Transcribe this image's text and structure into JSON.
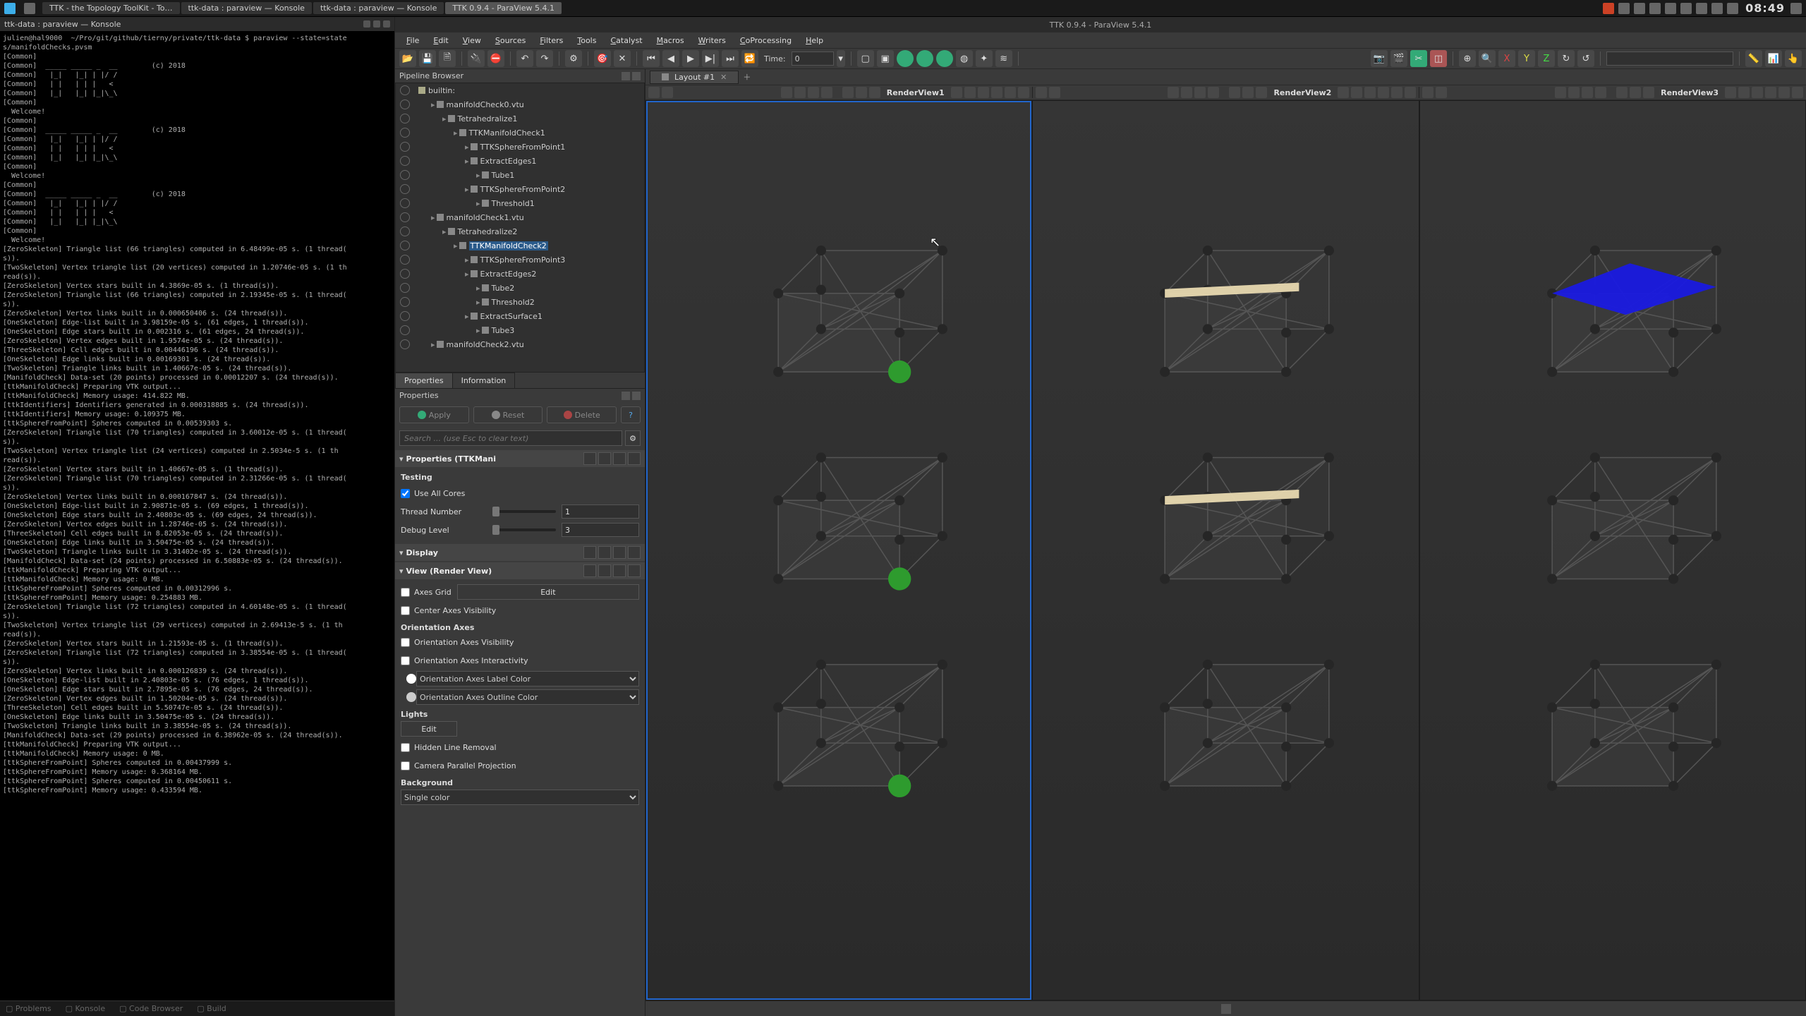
{
  "os": {
    "tasks": [
      {
        "label": "TTK - the Topology ToolKit - To…",
        "active": false
      },
      {
        "label": "ttk-data : paraview — Konsole",
        "active": false
      },
      {
        "label": "ttk-data : paraview — Konsole",
        "active": false
      },
      {
        "label": "TTK 0.9.4 - ParaView 5.4.1",
        "active": true
      }
    ],
    "clock": "08:49"
  },
  "terminal": {
    "title": "ttk-data : paraview — Konsole",
    "prompt": "julien@hal9000  ~/Pro/git/github/tierny/private/ttk-data $ paraview --state=state",
    "statefile": "s/manifoldChecks.pvsm",
    "welcome": "  Welcome!",
    "banner_left": "TTK",
    "banner_right": "(c) 2018",
    "lines": [
      "[ZeroSkeleton] Triangle list (66 triangles) computed in 6.48499e-05 s. (1 thread(",
      "s)).",
      "[TwoSkeleton] Vertex triangle list (20 vertices) computed in 1.20746e-05 s. (1 th",
      "read(s)).",
      "[ZeroSkeleton] Vertex stars built in 4.3869e-05 s. (1 thread(s)).",
      "[ZeroSkeleton] Triangle list (66 triangles) computed in 2.19345e-05 s. (1 thread(",
      "s)).",
      "[ZeroSkeleton] Vertex links built in 0.000650406 s. (24 thread(s)).",
      "[OneSkeleton] Edge-list built in 3.98159e-05 s. (61 edges, 1 thread(s)).",
      "[OneSkeleton] Edge stars built in 0.002316 s. (61 edges, 24 thread(s)).",
      "[ZeroSkeleton] Vertex edges built in 1.9574e-05 s. (24 thread(s)).",
      "[ThreeSkeleton] Cell edges built in 0.00446196 s. (24 thread(s)).",
      "[OneSkeleton] Edge links built in 0.00169301 s. (24 thread(s)).",
      "[TwoSkeleton] Triangle links built in 1.40667e-05 s. (24 thread(s)).",
      "[ManifoldCheck] Data-set (20 points) processed in 0.00012207 s. (24 thread(s)).",
      "[ttkManifoldCheck] Preparing VTK output...",
      "[ttkManifoldCheck] Memory usage: 414.822 MB.",
      "[ttkIdentifiers] Identifiers generated in 0.000318885 s. (24 thread(s)).",
      "[ttkIdentifiers] Memory usage: 0.109375 MB.",
      "[ttkSphereFromPoint] Spheres computed in 0.00539303 s.",
      "[ZeroSkeleton] Triangle list (70 triangles) computed in 3.60012e-05 s. (1 thread(",
      "s)).",
      "[TwoSkeleton] Vertex triangle list (24 vertices) computed in 2.5034e-5 s. (1 th",
      "read(s)).",
      "[ZeroSkeleton] Vertex stars built in 1.40667e-05 s. (1 thread(s)).",
      "[ZeroSkeleton] Triangle list (70 triangles) computed in 2.31266e-05 s. (1 thread(",
      "s)).",
      "[ZeroSkeleton] Vertex links built in 0.000167847 s. (24 thread(s)).",
      "[OneSkeleton] Edge-list built in 2.90871e-05 s. (69 edges, 1 thread(s)).",
      "[OneSkeleton] Edge stars built in 2.40803e-05 s. (69 edges, 24 thread(s)).",
      "[ZeroSkeleton] Vertex edges built in 1.28746e-05 s. (24 thread(s)).",
      "[ThreeSkeleton] Cell edges built in 8.82053e-05 s. (24 thread(s)).",
      "[OneSkeleton] Edge links built in 3.50475e-05 s. (24 thread(s)).",
      "[TwoSkeleton] Triangle links built in 3.31402e-05 s. (24 thread(s)).",
      "[ManifoldCheck] Data-set (24 points) processed in 6.50883e-05 s. (24 thread(s)).",
      "[ttkManifoldCheck] Preparing VTK output...",
      "[ttkManifoldCheck] Memory usage: 0 MB.",
      "[ttkSphereFromPoint] Spheres computed in 0.00312996 s.",
      "[ttkSphereFromPoint] Memory usage: 0.254883 MB.",
      "[ZeroSkeleton] Triangle list (72 triangles) computed in 4.60148e-05 s. (1 thread(",
      "s)).",
      "[TwoSkeleton] Vertex triangle list (29 vertices) computed in 2.69413e-5 s. (1 th",
      "read(s)).",
      "[ZeroSkeleton] Vertex stars built in 1.21593e-05 s. (1 thread(s)).",
      "[ZeroSkeleton] Triangle list (72 triangles) computed in 3.38554e-05 s. (1 thread(",
      "s)).",
      "[ZeroSkeleton] Vertex links built in 0.000126839 s. (24 thread(s)).",
      "[OneSkeleton] Edge-list built in 2.40803e-05 s. (76 edges, 1 thread(s)).",
      "[OneSkeleton] Edge stars built in 2.7895e-05 s. (76 edges, 24 thread(s)).",
      "[ZeroSkeleton] Vertex edges built in 1.50204e-05 s. (24 thread(s)).",
      "[ThreeSkeleton] Cell edges built in 5.50747e-05 s. (24 thread(s)).",
      "[OneSkeleton] Edge links built in 3.50475e-05 s. (24 thread(s)).",
      "[TwoSkeleton] Triangle links built in 3.38554e-05 s. (24 thread(s)).",
      "[ManifoldCheck] Data-set (29 points) processed in 6.38962e-05 s. (24 thread(s)).",
      "[ttkManifoldCheck] Preparing VTK output...",
      "[ttkManifoldCheck] Memory usage: 0 MB.",
      "[ttkSphereFromPoint] Spheres computed in 0.00437999 s.",
      "[ttkSphereFromPoint] Memory usage: 0.368164 MB.",
      "[ttkSphereFromPoint] Spheres computed in 0.00450611 s.",
      "[ttkSphereFromPoint] Memory usage: 0.433594 MB."
    ],
    "bottom_tabs": [
      "Problems",
      "Konsole",
      "Code Browser",
      "Build"
    ]
  },
  "paraview": {
    "title": "TTK 0.9.4 - ParaView 5.4.1",
    "menu": [
      "File",
      "Edit",
      "View",
      "Sources",
      "Filters",
      "Tools",
      "Catalyst",
      "Macros",
      "Writers",
      "CoProcessing",
      "Help"
    ],
    "time_label": "Time:",
    "time_value": "0",
    "layout_tab": "Layout #1",
    "views": [
      "RenderView1",
      "RenderView2",
      "RenderView3"
    ],
    "pipeline_title": "Pipeline Browser",
    "pipeline": [
      {
        "d": 0,
        "label": "builtin:",
        "ic": "srv"
      },
      {
        "d": 1,
        "label": "manifoldCheck0.vtu"
      },
      {
        "d": 2,
        "label": "Tetrahedralize1"
      },
      {
        "d": 3,
        "label": "TTKManifoldCheck1"
      },
      {
        "d": 4,
        "label": "TTKSphereFromPoint1"
      },
      {
        "d": 4,
        "label": "ExtractEdges1"
      },
      {
        "d": 5,
        "label": "Tube1"
      },
      {
        "d": 4,
        "label": "TTKSphereFromPoint2"
      },
      {
        "d": 5,
        "label": "Threshold1"
      },
      {
        "d": 1,
        "label": "manifoldCheck1.vtu"
      },
      {
        "d": 2,
        "label": "Tetrahedralize2"
      },
      {
        "d": 3,
        "label": "TTKManifoldCheck2",
        "sel": true
      },
      {
        "d": 4,
        "label": "TTKSphereFromPoint3"
      },
      {
        "d": 4,
        "label": "ExtractEdges2"
      },
      {
        "d": 5,
        "label": "Tube2"
      },
      {
        "d": 5,
        "label": "Threshold2"
      },
      {
        "d": 4,
        "label": "ExtractSurface1"
      },
      {
        "d": 5,
        "label": "Tube3"
      },
      {
        "d": 1,
        "label": "manifoldCheck2.vtu"
      }
    ],
    "tabs": {
      "props": "Properties",
      "info": "Information"
    },
    "props_title": "Properties",
    "buttons": {
      "apply": "Apply",
      "reset": "Reset",
      "delete": "Delete"
    },
    "search_ph": "Search ... (use Esc to clear text)",
    "sect_props": "Properties (TTKMani",
    "testing": "Testing",
    "use_all_cores": "Use All Cores",
    "thread_number": "Thread Number",
    "thread_number_v": "1",
    "debug_level": "Debug Level",
    "debug_level_v": "3",
    "sect_display": "Display",
    "sect_view": "View (Render View)",
    "axes_grid": "Axes Grid",
    "edit": "Edit",
    "center_axes": "Center Axes Visibility",
    "orient_axes": "Orientation Axes",
    "orient_vis": "Orientation Axes Visibility",
    "orient_int": "Orientation Axes Interactivity",
    "orient_lbl_c": "Orientation Axes Label Color",
    "orient_out_c": "Orientation Axes Outline Color",
    "lights": "Lights",
    "hidden_line": "Hidden Line Removal",
    "cam_parallel": "Camera Parallel Projection",
    "background": "Background",
    "bg_mode": "Single color"
  },
  "colors": {
    "vertex_green": "#2e9b2e",
    "edge_cream": "#e8d9b0",
    "face_blue": "#1a1ae0",
    "wire": "#555",
    "node": "#262626"
  }
}
